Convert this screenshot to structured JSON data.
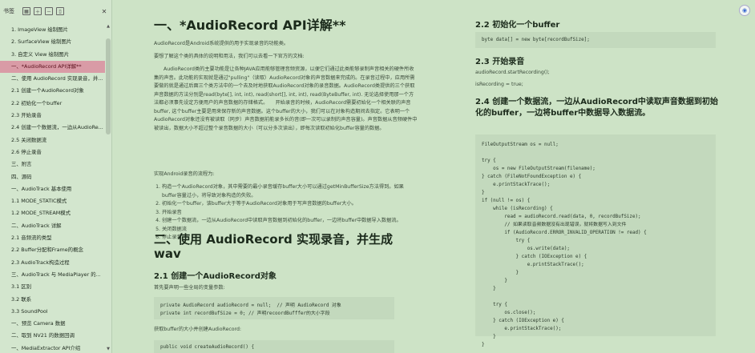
{
  "sidebar": {
    "title": "书签",
    "items": [
      "1. ImageView 绘制图片",
      "2. SurfaceView 绘制图片",
      "3. 自定义 View 绘制图片",
      "一、*AudioRecord API详解**",
      "二、使用 AudioRecord 实现录音，并...",
      "2.1 创建一个AudioRecord对象",
      "2.2 初始化一个buffer",
      "2.3 开始录音",
      "2.4 创建一个数据流，一边从AudioRe...",
      "2.5 关闭数据流",
      "2.6 停止录音",
      "三、附言",
      "四、源码",
      "一、AudioTrack 基本使用",
      "1.1 MODE_STATIC模式",
      "1.2 MODE_STREAM模式",
      "二、AudioTrack 详解",
      "2.1 音频流的类型",
      "2.2 Buffer分配和Frame的概念",
      "2.3 AudioTrack构造过程",
      "三、AudioTrack 与 MediaPlayer 的...",
      "3.1 区别",
      "3.2 联系",
      "3.3 SoundPool",
      "一、预览 Camera 数据",
      "二、取到 NV21 的数据回调",
      "一、MediaExtractor API介绍"
    ],
    "active_index": 3
  },
  "left": {
    "h1a": "一、*AudioRecord API详解**",
    "p1": "AudioRecord是Android系统提供的用于实现录音的功能类。",
    "p2": "要想了解这个类的具体的说明和用法，我们可以去看一下官方的文档:",
    "p3": "AudioRecord类的主要功能是让各种JAVA应用能够管理音频资源，以便它们通过此类能够录制声音相关的硬件所收集的声音。此功能的实现就是通过\"pulling\"（读取）AudioRecord对象的声音数据来完成的。在录音过程中，应用所需要做的就是通过后面三个类方法中的一个去及时地获取AudioRecord对象的录音数据。AudioRecord类提供的三个获取声音数据的方法分别是read(byte[], int, int), read(short[], int, int), read(ByteBuffer, int). 无论选择使用那一个方法都必须事先设定方便用户的声音数据的存储格式。　　开始录音的时候，AudioRecord需要初始化一个相关联的声音buffer, 这个buffer主要是用来保存新的声音数据。这个buffer的大小，我们可以在对象构造期间去指定。它表明一个AudioRecord对象还没有被读取（同步）声音数据前能录多长的音(即一次可以录制的声音容量)。声音数据从音频硬件中被读出，数据大小不超过整个录音数据的大小（可以分多次读出），即每次读取初始化buffer容量的数据。",
    "p4": "实现Android录音的流程为:",
    "steps": [
      "构造一个AudioRecord对象，其中需要的最小录音缓存buffer大小可以通过getMinBufferSize方法得到。如果buffer容量过小，将导致对象构造的失败。",
      "初始化一个buffer，该buffer大于等于AudioRecord对象用于写声音数据的buffer大小。",
      "开始录音",
      "创建一个数据流，一边从AudioRecord中读取声音数据到初始化的buffer，一边将buffer中数据导入数据流。",
      "关闭数据流",
      "停止录音"
    ],
    "h1b": "二、使用 AudioRecord 实现录音，并生成wav",
    "h2_21": "2.1 创建一个AudioRecord对象",
    "p5": "首先要声明一些全局的变量参数:",
    "code1": "private AudioRecord audioRecord = null;  // 声明 AudioRecord 对象\nprivate int recordBufSize = 0; // 声明recoordBufffer的大小字段",
    "p6": "获取buffer的大小并创建AudioRecord:",
    "code2": "public void createAudioRecord() {"
  },
  "right": {
    "h2_22": "2.2 初始化一个buffer",
    "code_22": "byte data[] = new byte[recordBufSize];",
    "h2_23": "2.3 开始录音",
    "p_23a": "audioRecord.startRecording();",
    "p_23b": "isRecording = true;",
    "h2_24": "2.4 创建一个数据流，一边从AudioRecord中读取声音数据到初始化的buffer，一边将buffer中数据导入数据流。",
    "code_24": "FileOutputStream os = null;\n\ntry {\n    os = new FileOutputStream(filename);\n} catch (FileNotFoundException e) {\n    e.printStackTrace();\n}\nif (null != os) {\n    while (isRecording) {\n        read = audioRecord.read(data, 0, recordBufSize);\n        // 如果读取音频数据没有出现错误，就将数据写入到文件\n        if (AudioRecord.ERROR_INVALID_OPERATION != read) {\n            try {\n                os.write(data);\n            } catch (IOException e) {\n                e.printStackTrace();\n            }\n        }\n    }\n\n    try {\n        os.close();\n    } catch (IOException e) {\n        e.printStackTrace();\n    }\n}"
  }
}
